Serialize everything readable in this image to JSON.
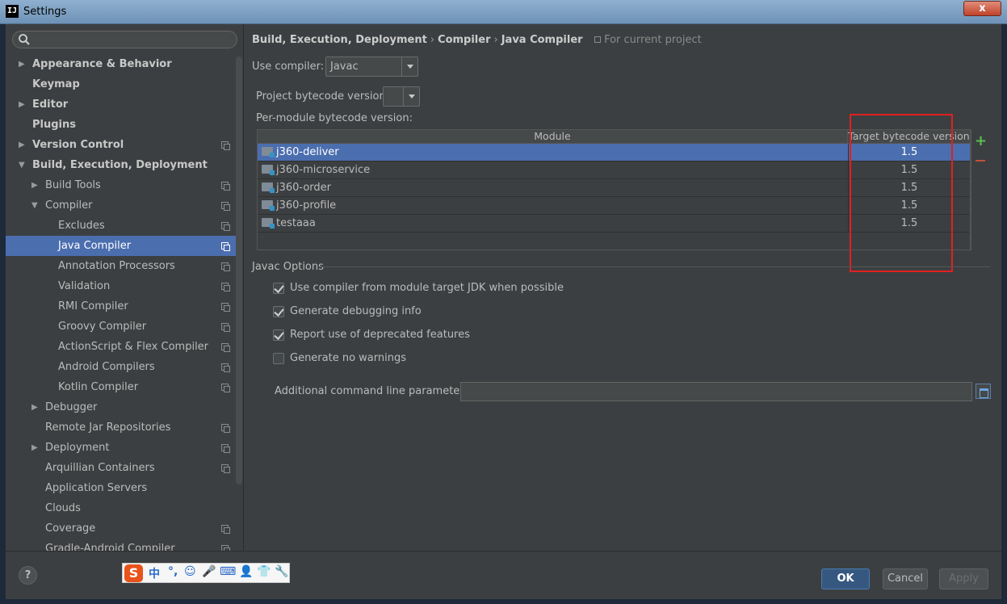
{
  "window": {
    "title": "Settings",
    "close_label": "x"
  },
  "sidebar": {
    "items": [
      {
        "label": "Appearance & Behavior",
        "arrow": "▶"
      },
      {
        "label": "Keymap",
        "arrow": ""
      },
      {
        "label": "Editor",
        "arrow": "▶"
      },
      {
        "label": "Plugins",
        "arrow": ""
      },
      {
        "label": "Version Control",
        "arrow": "▶"
      },
      {
        "label": "Build, Execution, Deployment",
        "arrow": "▼"
      },
      {
        "label": "Build Tools",
        "arrow": "▶"
      },
      {
        "label": "Compiler",
        "arrow": "▼"
      },
      {
        "label": "Excludes",
        "arrow": ""
      },
      {
        "label": "Java Compiler",
        "arrow": ""
      },
      {
        "label": "Annotation Processors",
        "arrow": ""
      },
      {
        "label": "Validation",
        "arrow": ""
      },
      {
        "label": "RMI Compiler",
        "arrow": ""
      },
      {
        "label": "Groovy Compiler",
        "arrow": ""
      },
      {
        "label": "ActionScript & Flex Compiler",
        "arrow": ""
      },
      {
        "label": "Android Compilers",
        "arrow": ""
      },
      {
        "label": "Kotlin Compiler",
        "arrow": ""
      },
      {
        "label": "Debugger",
        "arrow": "▶"
      },
      {
        "label": "Remote Jar Repositories",
        "arrow": ""
      },
      {
        "label": "Deployment",
        "arrow": "▶"
      },
      {
        "label": "Arquillian Containers",
        "arrow": ""
      },
      {
        "label": "Application Servers",
        "arrow": ""
      },
      {
        "label": "Clouds",
        "arrow": ""
      },
      {
        "label": "Coverage",
        "arrow": ""
      },
      {
        "label": "Gradle-Android Compiler",
        "arrow": ""
      }
    ]
  },
  "breadcrumb": {
    "part1": "Build, Execution, Deployment",
    "part2": "Compiler",
    "part3": "Java Compiler",
    "sep": "›",
    "scope": "For current project"
  },
  "form": {
    "use_compiler_label": "Use compiler:",
    "use_compiler_value": "Javac",
    "project_bytecode_label": "Project bytecode version:",
    "project_bytecode_value": "",
    "per_module_label": "Per-module bytecode version:"
  },
  "table": {
    "headers": [
      "Module",
      "Target bytecode version"
    ],
    "rows": [
      {
        "module": "j360-deliver",
        "version": "1.5"
      },
      {
        "module": "j360-microservice",
        "version": "1.5"
      },
      {
        "module": "j360-order",
        "version": "1.5"
      },
      {
        "module": "j360-profile",
        "version": "1.5"
      },
      {
        "module": "testaaa",
        "version": "1.5"
      }
    ],
    "add_label": "+"
  },
  "javac": {
    "section_title": "Javac Options",
    "options": [
      {
        "label": "Use compiler from module target JDK when possible",
        "checked": true
      },
      {
        "label": "Generate debugging info",
        "checked": true
      },
      {
        "label": "Report use of deprecated features",
        "checked": true
      },
      {
        "label": "Generate no warnings",
        "checked": false
      }
    ],
    "params_label": "Additional command line parameters:",
    "params_value": ""
  },
  "buttons": {
    "help": "?",
    "ok": "OK",
    "cancel": "Cancel",
    "apply": "Apply"
  },
  "ime": {
    "logo": "S",
    "items": [
      "中",
      "°,",
      "☺",
      "🎤",
      "⌨",
      "👤",
      "👕",
      "🔧"
    ]
  },
  "colors": {
    "selection": "#4b6eaf",
    "background": "#3c3f41",
    "highlight_box": "#e02020"
  }
}
